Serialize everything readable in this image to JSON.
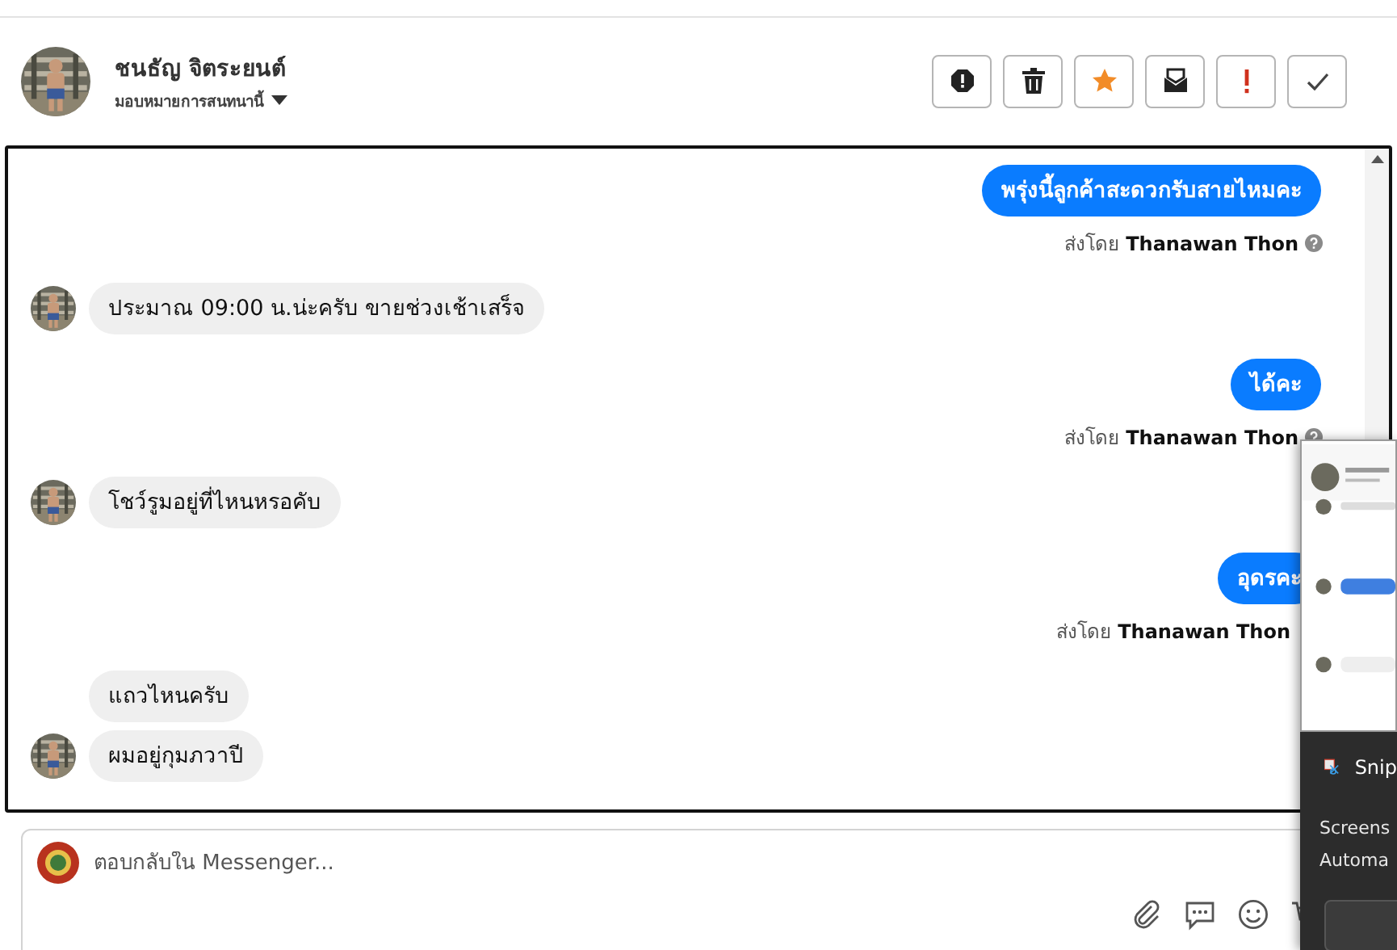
{
  "contact": {
    "name": "ชนธัญ จิตระยนต์",
    "assign": "มอบหมายการสนทนานี้"
  },
  "actions": [
    {
      "kind": "spam"
    },
    {
      "kind": "delete"
    },
    {
      "kind": "star"
    },
    {
      "kind": "mail"
    },
    {
      "kind": "important"
    },
    {
      "kind": "done"
    }
  ],
  "messages": [
    {
      "kind": "outgoing",
      "text": "พรุ่งนี้ลูกค้าสะดวกรับสายไหมคะ",
      "sent_by_label": "ส่งโดย",
      "sender": "Thanawan Thon",
      "help_icon": true
    },
    {
      "kind": "incoming",
      "text": "ประมาณ 09:00 น.น่ะครับ ขายช่วงเช้าเสร็จ",
      "avatar": true
    },
    {
      "kind": "outgoing",
      "text": "ได้คะ",
      "sent_by_label": "ส่งโดย",
      "sender": "Thanawan Thon",
      "help_icon": true
    },
    {
      "kind": "incoming",
      "text": "โชว์รูมอยู่ที่ไหนหรอคับ",
      "avatar": true
    },
    {
      "kind": "outgoing",
      "text": "อุดรคะ",
      "sent_by_label": "ส่งโดย",
      "sender": "Thanawan Thon",
      "help_icon": false
    },
    {
      "kind": "incoming",
      "text": "แถวไหนครับ",
      "avatar": false
    },
    {
      "kind": "incoming",
      "text": "ผมอยู่กุมภวาปี",
      "avatar": true
    }
  ],
  "reply": {
    "placeholder": "ตอบกลับใน Messenger..."
  },
  "notification": {
    "app": "Snip",
    "lines": [
      "Screens",
      "Automa"
    ]
  }
}
